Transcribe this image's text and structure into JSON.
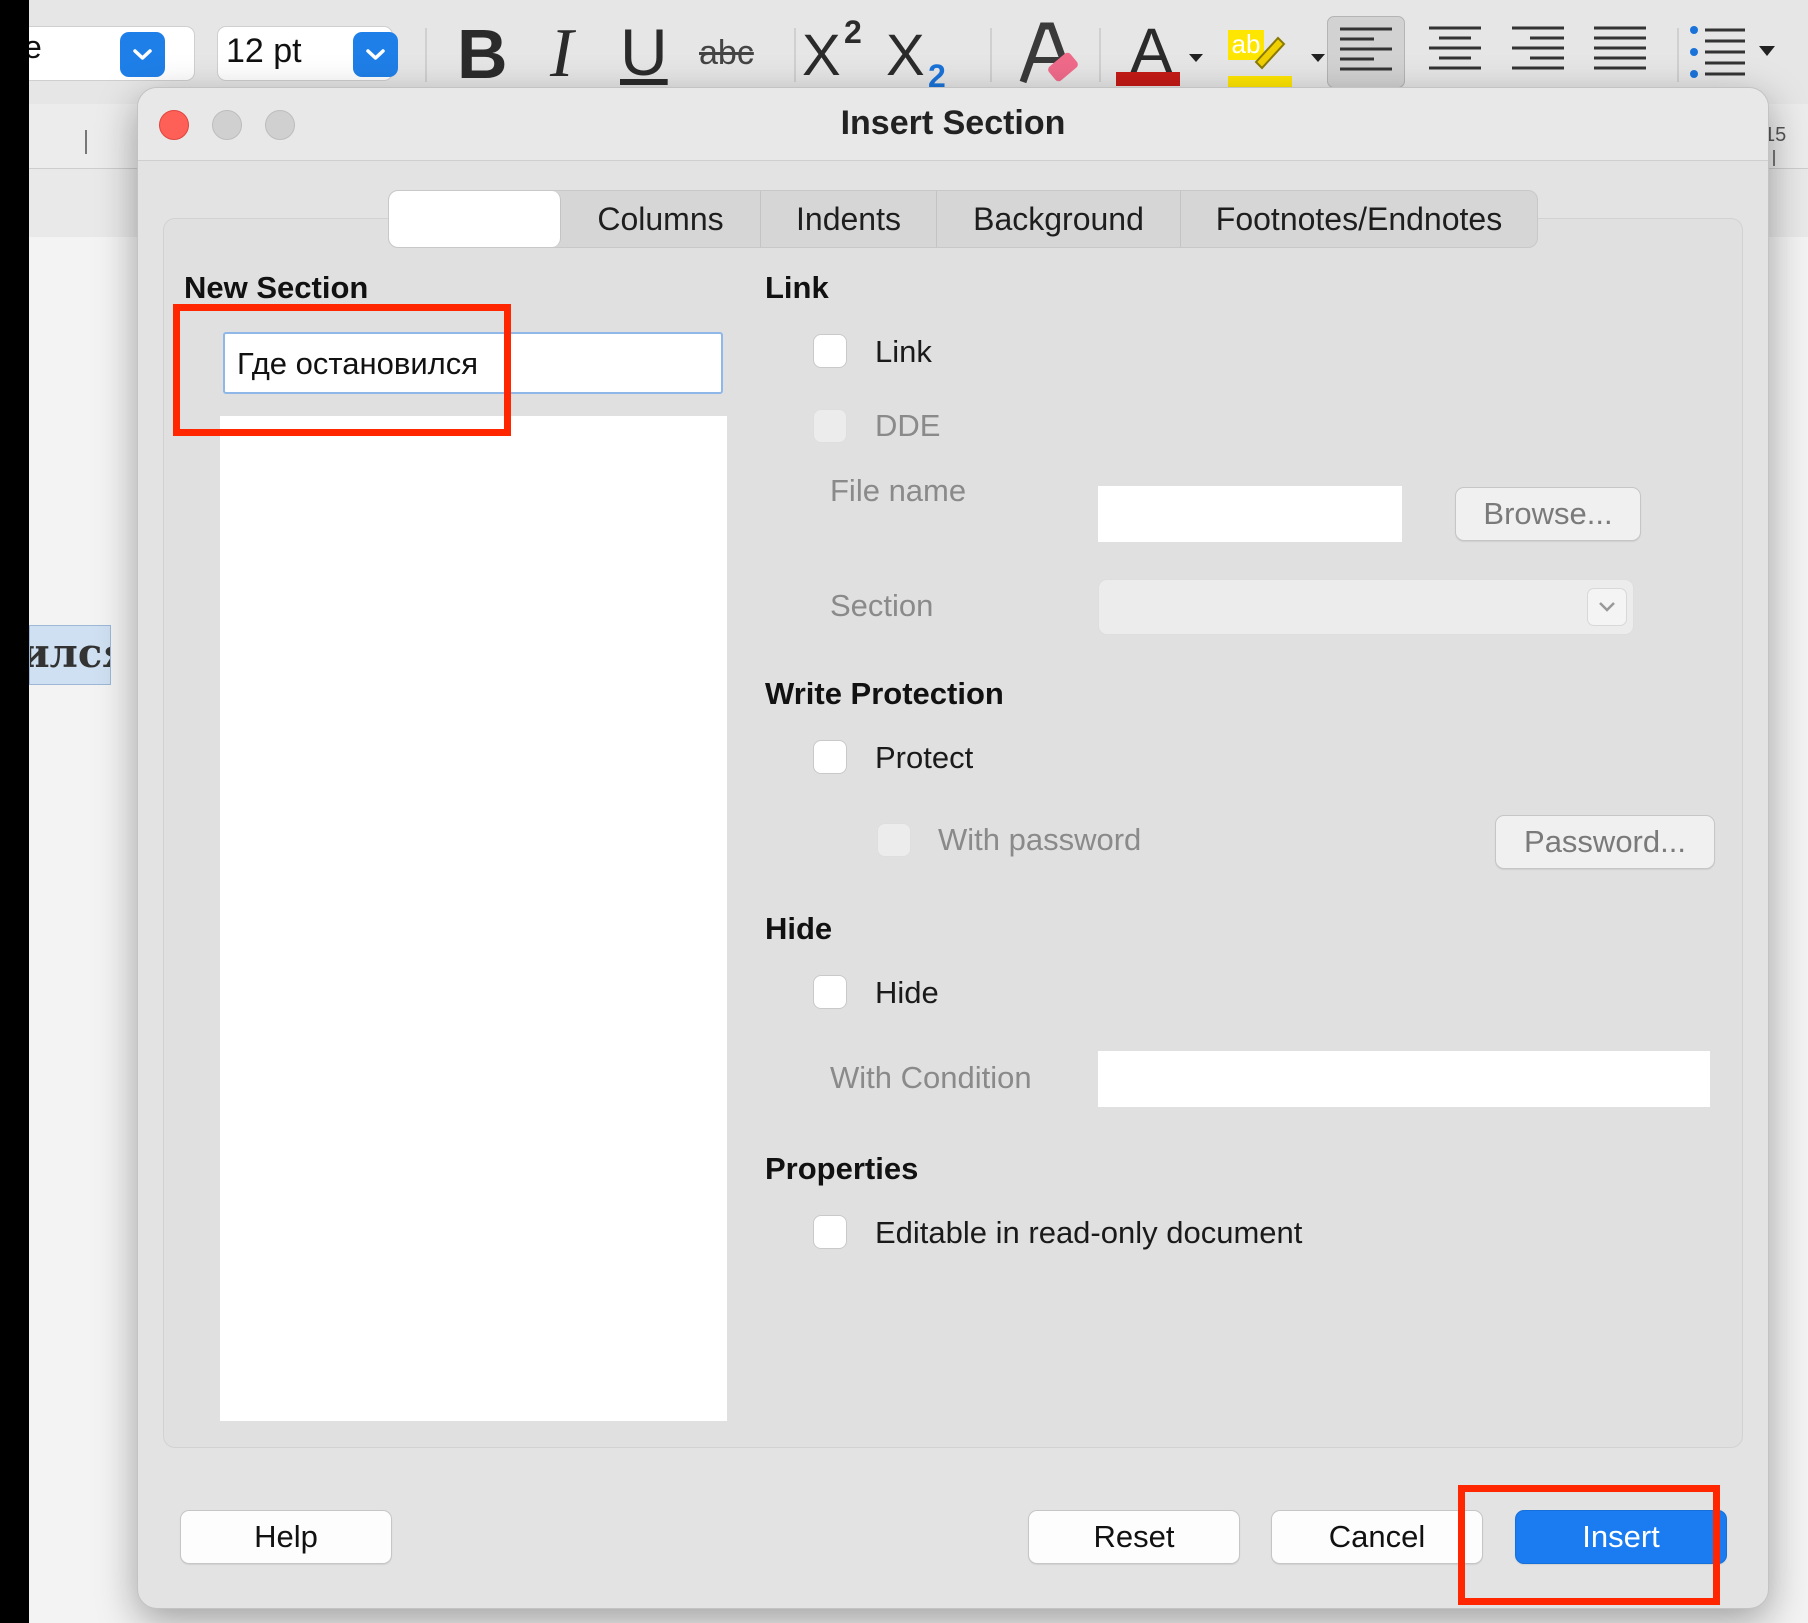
{
  "toolbar": {
    "font_name_partial": "e",
    "font_size": "12 pt",
    "bold_glyph": "B",
    "italic_glyph": "I",
    "underline_glyph": "U",
    "strikethrough_glyph": "abc",
    "superscript_glyph": "X",
    "superscript_exp": "2",
    "subscript_glyph": "X",
    "subscript_exp": "2",
    "font_color_glyph": "A",
    "highlight_glyph": "ab",
    "font_color_bar": "#c41a16",
    "highlight_bar": "#ffe600"
  },
  "ruler": {
    "mark": "15"
  },
  "document": {
    "fragment_text": "ился"
  },
  "dialog": {
    "title": "Insert Section",
    "tabs": [
      {
        "label": "",
        "active": true
      },
      {
        "label": "Columns"
      },
      {
        "label": "Indents"
      },
      {
        "label": "Background"
      },
      {
        "label": "Footnotes/Endnotes"
      }
    ],
    "new_section": {
      "heading": "New Section",
      "name_value": "Где остановился"
    },
    "link": {
      "heading": "Link",
      "link_checkbox": "Link",
      "dde_checkbox": "DDE",
      "file_name_label": "File name",
      "browse_button": "Browse...",
      "section_label": "Section"
    },
    "write_protection": {
      "heading": "Write Protection",
      "protect_checkbox": "Protect",
      "with_password_checkbox": "With password",
      "password_button": "Password..."
    },
    "hide": {
      "heading": "Hide",
      "hide_checkbox": "Hide",
      "with_condition_label": "With Condition"
    },
    "properties": {
      "heading": "Properties",
      "editable_checkbox": "Editable in read-only document"
    },
    "buttons": {
      "help": "Help",
      "reset": "Reset",
      "cancel": "Cancel",
      "insert": "Insert"
    }
  },
  "colors": {
    "accent": "#1a7cf0",
    "annotation": "#ff2600"
  }
}
